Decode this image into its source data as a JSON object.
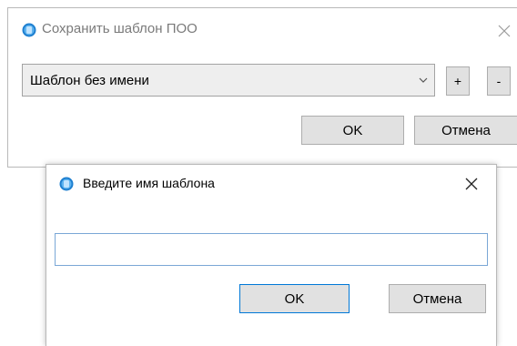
{
  "save_dialog": {
    "title": "Сохранить шаблон ПОО",
    "template_select": {
      "value": "Шаблон без имени"
    },
    "add_label": "+",
    "remove_label": "-",
    "ok_label": "OK",
    "cancel_label": "Отмена"
  },
  "name_dialog": {
    "title": "Введите имя шаблона",
    "input": {
      "value": "",
      "placeholder": ""
    },
    "ok_label": "OK",
    "cancel_label": "Отмена"
  },
  "colors": {
    "app_icon_outer": "#1e7fd0",
    "app_icon_inner": "#bfe3ff",
    "focus_border": "#0078d7"
  }
}
